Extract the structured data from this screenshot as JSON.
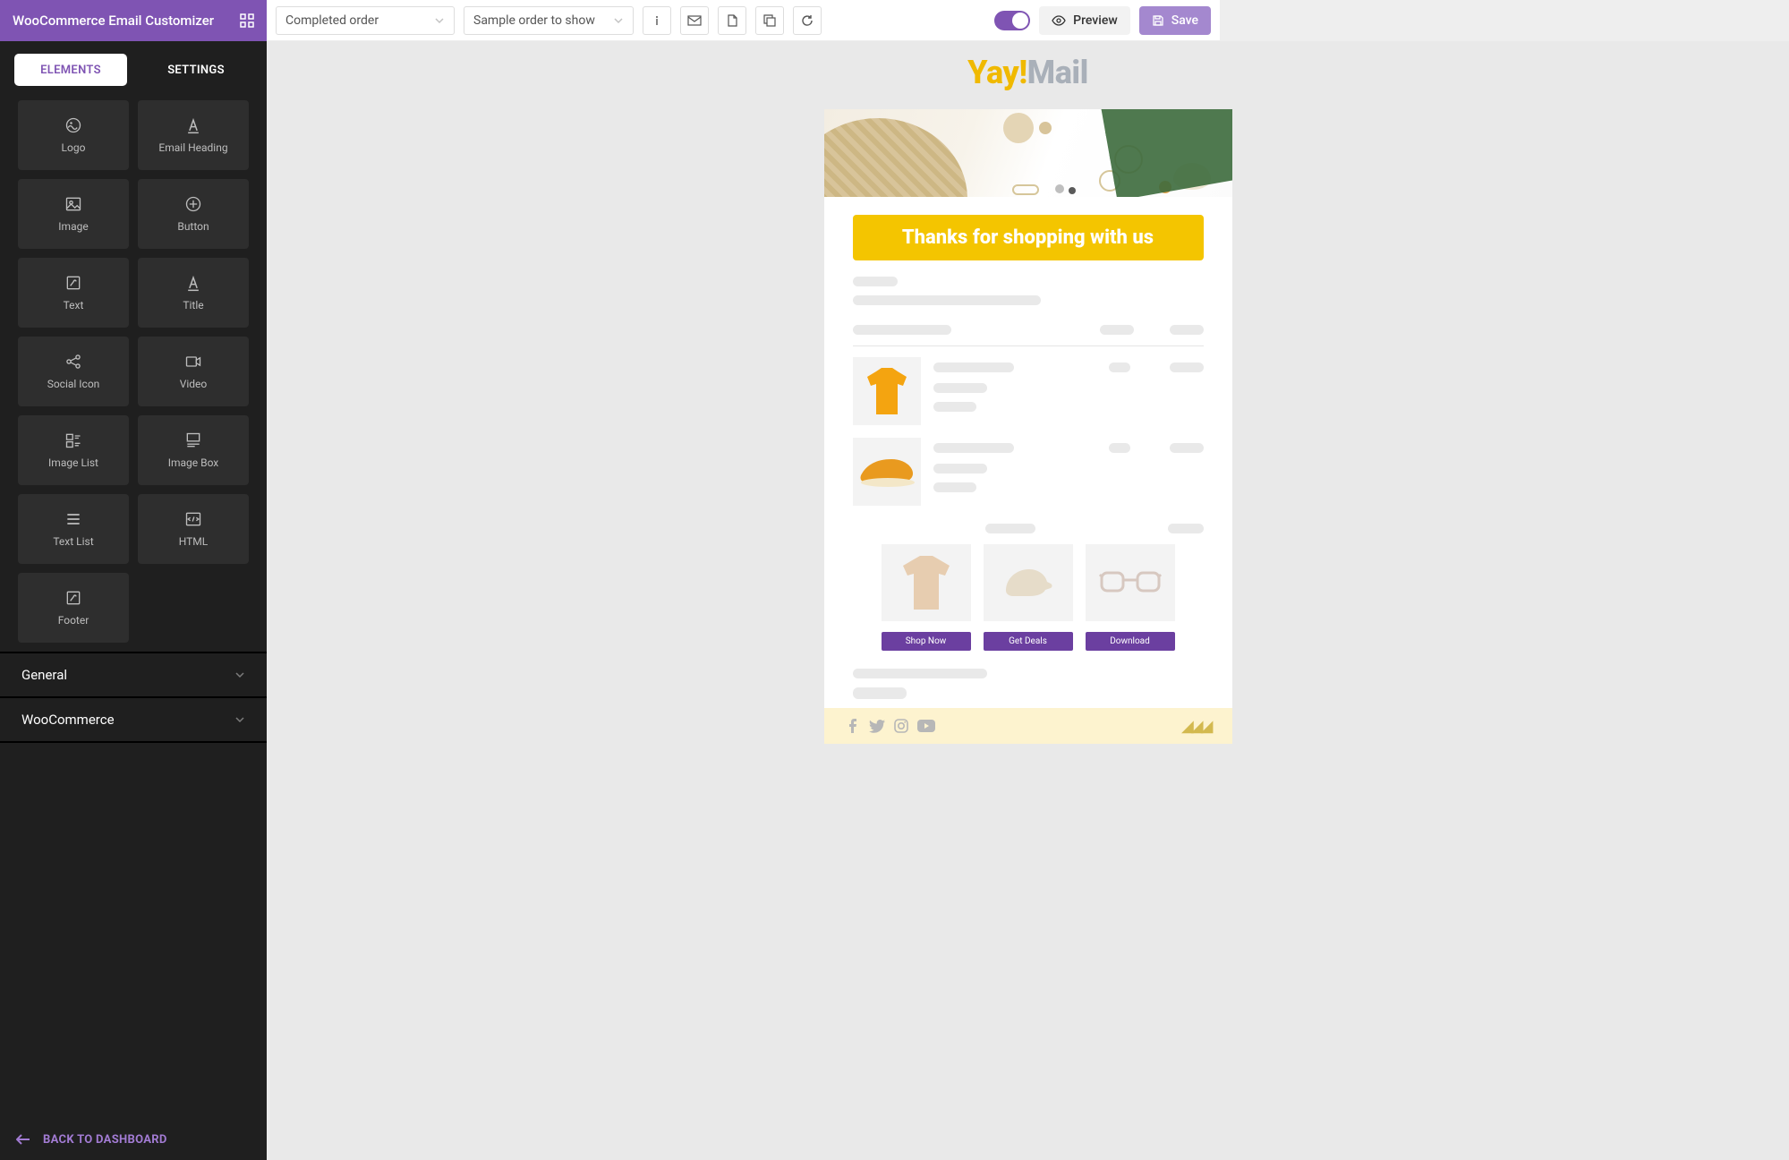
{
  "brand": "WooCommerce Email Customizer",
  "toolbar": {
    "select_template": "Completed order",
    "select_sample": "Sample order to show",
    "preview_label": "Preview",
    "save_label": "Save"
  },
  "tabs": {
    "elements": "ELEMENTS",
    "settings": "SETTINGS"
  },
  "elements": [
    {
      "id": "logo",
      "label": "Logo",
      "icon": "logo"
    },
    {
      "id": "email-heading",
      "label": "Email Heading",
      "icon": "heading"
    },
    {
      "id": "image",
      "label": "Image",
      "icon": "image"
    },
    {
      "id": "button",
      "label": "Button",
      "icon": "button"
    },
    {
      "id": "text",
      "label": "Text",
      "icon": "text"
    },
    {
      "id": "title",
      "label": "Title",
      "icon": "title"
    },
    {
      "id": "social-icon",
      "label": "Social Icon",
      "icon": "social"
    },
    {
      "id": "video",
      "label": "Video",
      "icon": "video"
    },
    {
      "id": "image-list",
      "label": "Image List",
      "icon": "imagelist"
    },
    {
      "id": "image-box",
      "label": "Image Box",
      "icon": "imagebox"
    },
    {
      "id": "text-list",
      "label": "Text List",
      "icon": "textlist"
    },
    {
      "id": "html",
      "label": "HTML",
      "icon": "html"
    },
    {
      "id": "footer",
      "label": "Footer",
      "icon": "footer"
    }
  ],
  "accordion": [
    "General",
    "WooCommerce"
  ],
  "back_label": "BACK TO DASHBOARD",
  "logo": {
    "part1": "Yay",
    "part2": "!",
    "part3": "Mail"
  },
  "email": {
    "banner": "Thanks for shopping with us",
    "cta": [
      "Shop Now",
      "Get Deals",
      "Download"
    ]
  }
}
